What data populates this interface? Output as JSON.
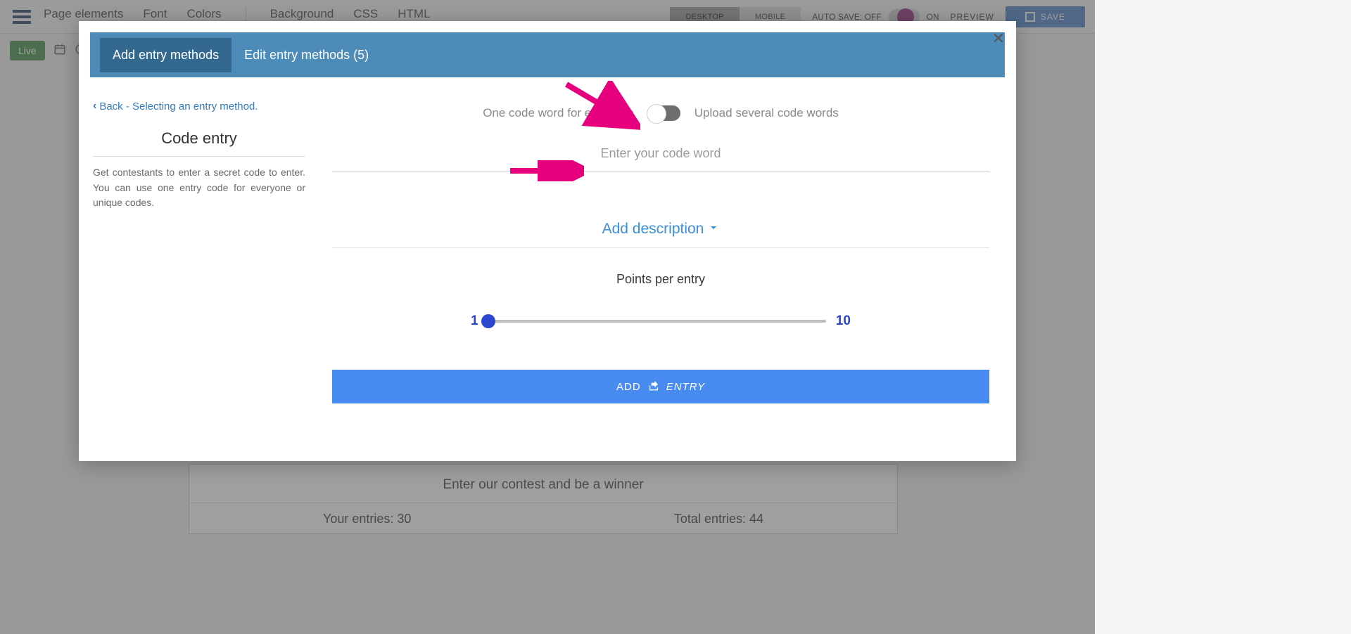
{
  "topnav": {
    "items": [
      "Page elements",
      "Font",
      "Colors",
      "Background",
      "CSS",
      "HTML"
    ],
    "device_tabs": {
      "desktop": "DESKTOP",
      "mobile": "MOBILE"
    },
    "auto_save_off": "AUTO SAVE: OFF",
    "on_label": "ON",
    "preview": "PREVIEW",
    "save": "SAVE"
  },
  "subbar": {
    "live": "Live"
  },
  "bg_card": {
    "title": "Enter our contest and be a winner",
    "your_entries": "Your entries: 30",
    "total_entries": "Total entries: 44"
  },
  "modal": {
    "tab_add": "Add entry methods",
    "tab_edit": "Edit entry methods (5)",
    "back_link": "Back - Selecting an entry method.",
    "left_title": "Code entry",
    "left_desc": "Get contestants to enter a secret code to enter. You can use one entry code for everyone or unique codes.",
    "toggle_left": "One code word for everyone",
    "toggle_right": "Upload several code words",
    "code_placeholder": "Enter your code word",
    "add_description": "Add description",
    "points_per_entry": "Points per entry",
    "slider_min": "1",
    "slider_max": "10",
    "add_btn_prefix": "ADD",
    "add_btn_entry": "ENTRY"
  }
}
